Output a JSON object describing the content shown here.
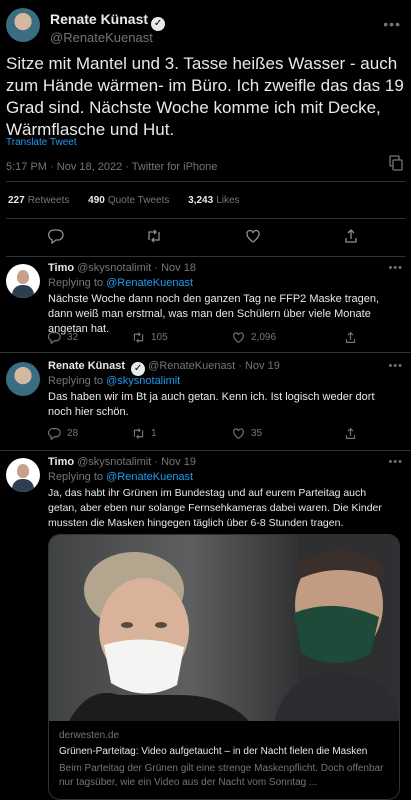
{
  "main_tweet": {
    "author_name": "Renate Künast",
    "author_handle": "@RenateKuenast",
    "text": "Sitze mit Mantel und 3. Tasse heißes Wasser - auch zum Hände wärmen- im Büro. Ich zweifle das das 19 Grad sind. Nächste Woche komme ich mit Decke, Wärmflasche und Hut.",
    "translate_label": "Translate Tweet",
    "time": "5:17 PM",
    "date": "Nov 18, 2022",
    "source": "Twitter for iPhone",
    "retweets_count": "227",
    "retweets_label": "Retweets",
    "quotes_count": "490",
    "quotes_label": "Quote Tweets",
    "likes_count": "3,243",
    "likes_label": "Likes"
  },
  "replies": [
    {
      "author_name": "Timo",
      "author_handle": "@skysnotalimit",
      "date": "Nov 18",
      "replying_label": "Replying to",
      "replying_to": "@RenateKuenast",
      "text": "Nächste Woche dann noch den ganzen Tag ne FFP2 Maske tragen, dann weiß man erstmal, was man den Schülern über viele Monate angetan hat.",
      "reply_count": "32",
      "retweet_count": "105",
      "like_count": "2,096"
    },
    {
      "author_name": "Renate Künast",
      "author_handle": "@RenateKuenast",
      "date": "Nov 19",
      "replying_label": "Replying to",
      "replying_to": "@skysnotalimit",
      "text": "Das haben wir im Bt ja auch getan. Kenn ich. Ist logisch weder dort noch hier schön.",
      "reply_count": "28",
      "retweet_count": "1",
      "like_count": "35"
    },
    {
      "author_name": "Timo",
      "author_handle": "@skysnotalimit",
      "date": "Nov 19",
      "replying_label": "Replying to",
      "replying_to": "@RenateKuenast",
      "text": "Ja, das habt ihr Grünen im Bundestag und auf eurem Parteitag auch getan, aber eben nur solange Fernsehkameras dabei waren. Die Kinder mussten die Masken hingegen täglich über 6-8 Stunden tragen.",
      "card": {
        "domain": "derwesten.de",
        "title": "Grünen-Parteitag: Video aufgetaucht – in der Nacht fielen die Masken",
        "description": "Beim Parteitag der Grünen gilt eine strenge Maskenpflicht. Doch offenbar nur tagsüber, wie ein Video aus der Nacht vom Sonntag ..."
      }
    }
  ],
  "separator": "·",
  "colors": {
    "background": "#000000",
    "text": "#e7e9ea",
    "muted": "#71767b",
    "link": "#1d9bf0",
    "divider": "#2f3336"
  },
  "icons": [
    "more-icon",
    "verified-icon",
    "reply-icon",
    "retweet-icon",
    "like-icon",
    "share-icon",
    "chart-icon",
    "switch-icon"
  ]
}
